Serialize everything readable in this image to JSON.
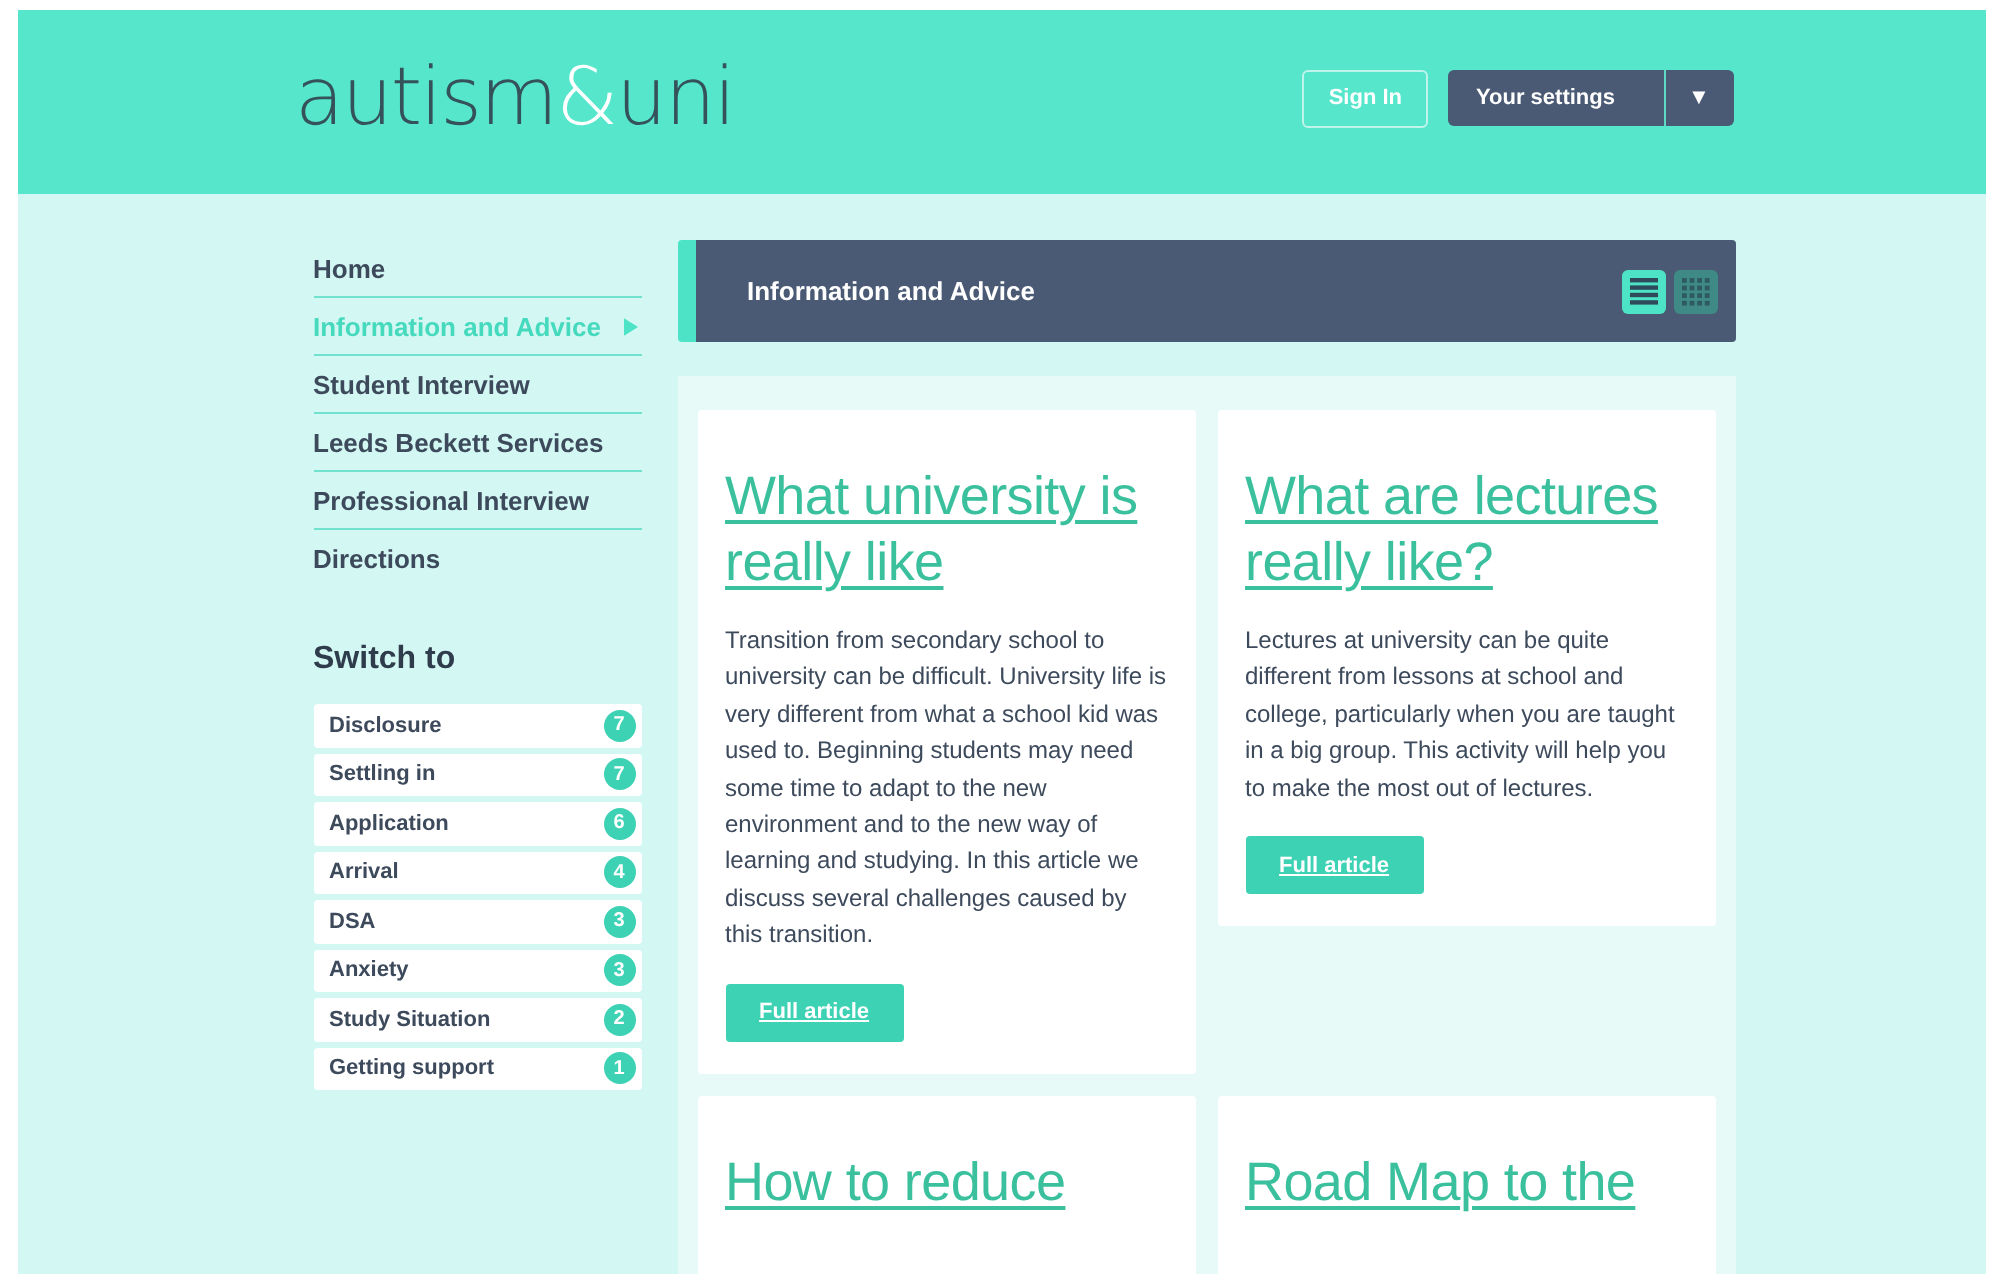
{
  "header": {
    "logo": {
      "before": "autism",
      "ampersand": "&",
      "after": "uni"
    },
    "sign_in": "Sign In",
    "settings": "Your settings",
    "settings_caret": "▼"
  },
  "nav": [
    {
      "label": "Home",
      "selected": false
    },
    {
      "label": "Information and Advice",
      "selected": true
    },
    {
      "label": "Student Interview",
      "selected": false
    },
    {
      "label": "Leeds Beckett Services",
      "selected": false
    },
    {
      "label": "Professional Interview",
      "selected": false
    },
    {
      "label": "Directions",
      "selected": false
    }
  ],
  "switch_to": {
    "title": "Switch to",
    "items": [
      {
        "label": "Disclosure",
        "count": "7"
      },
      {
        "label": "Settling in",
        "count": "7"
      },
      {
        "label": "Application",
        "count": "6"
      },
      {
        "label": "Arrival",
        "count": "4"
      },
      {
        "label": "DSA",
        "count": "3"
      },
      {
        "label": "Anxiety",
        "count": "3"
      },
      {
        "label": "Study Situation",
        "count": "2"
      },
      {
        "label": "Getting support",
        "count": "1"
      }
    ]
  },
  "section": {
    "title": "Information and Advice",
    "views": [
      {
        "kind": "list",
        "selected": true
      },
      {
        "kind": "grid",
        "selected": false
      }
    ]
  },
  "articles": [
    {
      "title": "What university is really like",
      "summary": "Transition from secondary school to university can be difficult. University life is very different from what a school kid was used to. Beginning students may need some time to adapt to the new environment and to the new way of learning and studying. In this article we discuss several challenges caused by this transition.",
      "button": "Full article"
    },
    {
      "title": "What are lectures really like?",
      "summary": "Lectures at university can be quite different from lessons at school and college, particularly when you are taught in a big group. This activity will help you to make the most out of lectures.",
      "button": "Full article"
    },
    {
      "title": "How to reduce"
    },
    {
      "title": "Road Map to the"
    }
  ]
}
